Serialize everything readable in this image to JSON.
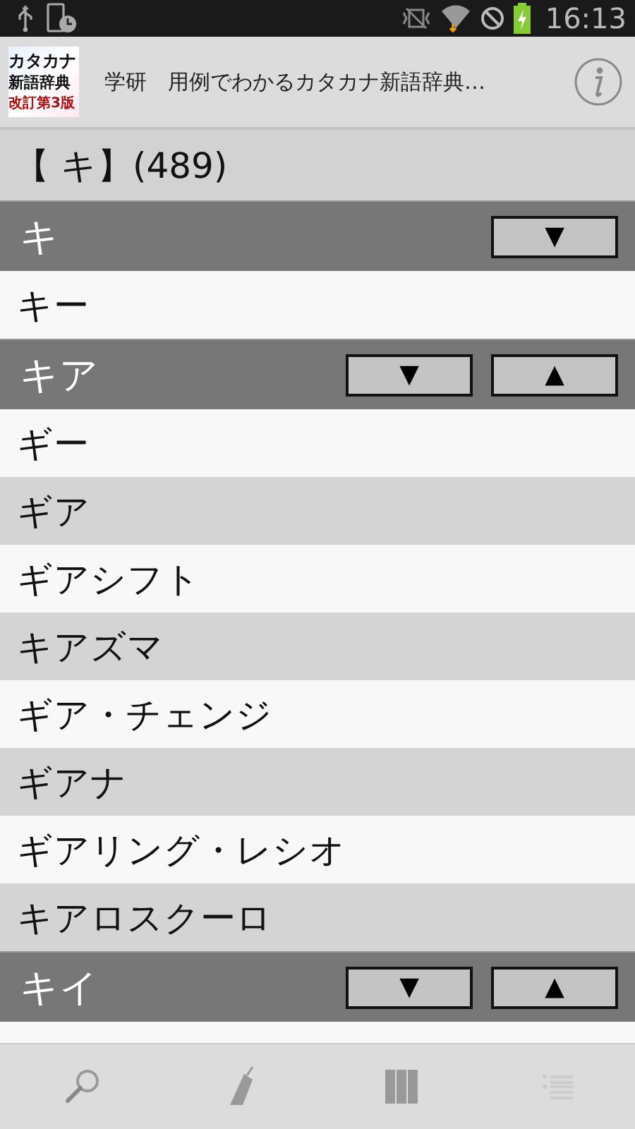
{
  "status_bar": {
    "time": "16:13"
  },
  "header": {
    "logo_lines": [
      "カタカナ",
      "新語辞典",
      "改訂第3版"
    ],
    "title": "学研　用例でわかるカタカナ新語辞典…"
  },
  "index_heading": "【 キ】(489)",
  "rows": [
    {
      "kind": "header",
      "text": "キ",
      "buttons": [
        "▼"
      ]
    },
    {
      "kind": "entry",
      "text": "キー",
      "shaded": false
    },
    {
      "kind": "header",
      "text": "キア",
      "buttons": [
        "▼",
        "▲"
      ]
    },
    {
      "kind": "entry",
      "text": "ギー",
      "shaded": false
    },
    {
      "kind": "entry",
      "text": "ギア",
      "shaded": true
    },
    {
      "kind": "entry",
      "text": "ギアシフト",
      "shaded": false
    },
    {
      "kind": "entry",
      "text": "キアズマ",
      "shaded": true
    },
    {
      "kind": "entry",
      "text": "ギア・チェンジ",
      "shaded": false
    },
    {
      "kind": "entry",
      "text": "ギアナ",
      "shaded": true
    },
    {
      "kind": "entry",
      "text": "ギアリング・レシオ",
      "shaded": false
    },
    {
      "kind": "entry",
      "text": "キアロスクーロ",
      "shaded": true
    },
    {
      "kind": "header",
      "text": "キイ",
      "buttons": [
        "▼",
        "▲"
      ]
    }
  ]
}
